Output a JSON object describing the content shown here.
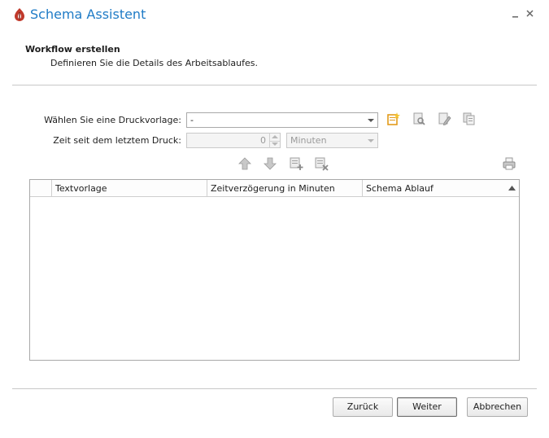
{
  "window": {
    "title": "Schema Assistent",
    "minimize_icon": "minimize-icon",
    "close_icon": "close-icon"
  },
  "header": {
    "title": "Workflow erstellen",
    "subtitle": "Definieren Sie die Details des Arbeitsablaufes."
  },
  "form": {
    "template_label": "Wählen Sie eine Druckvorlage:",
    "template_value": "-",
    "time_label": "Zeit seit dem letztem Druck:",
    "time_value": "0",
    "unit_value": "Minuten"
  },
  "toolbar_icons": [
    "new-template-icon",
    "preview-template-icon",
    "edit-template-icon",
    "copy-template-icon",
    "move-up-icon",
    "move-down-icon",
    "add-row-icon",
    "delete-row-icon",
    "print-icon"
  ],
  "table": {
    "columns": [
      "",
      "Textvorlage",
      "Zeitverzögerung in Minuten",
      "Schema Ablauf"
    ],
    "rows": []
  },
  "footer": {
    "back_label": "Zurück",
    "next_label": "Weiter",
    "cancel_label": "Abbrechen"
  },
  "colors": {
    "title": "#1f7bc6",
    "accent_red": "#c0392b",
    "icon_orange": "#e39b1a"
  }
}
